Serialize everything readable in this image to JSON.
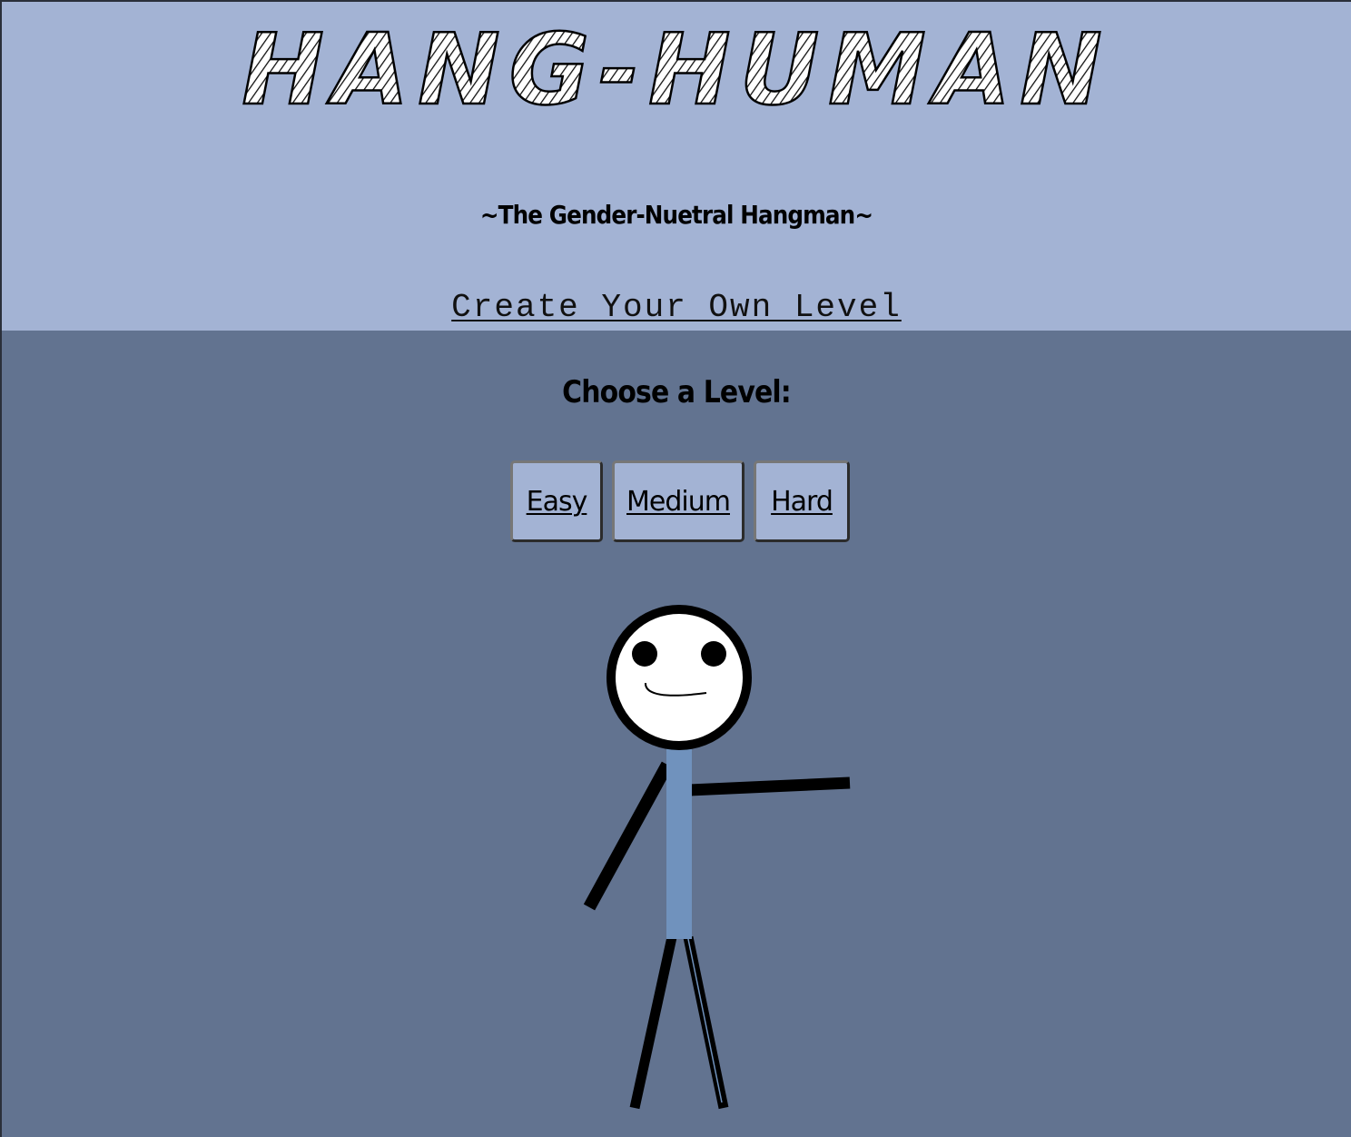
{
  "header": {
    "title": "HANG-HUMAN",
    "subtitle": "~The Gender-Nuetral Hangman~",
    "create_link": "Create Your Own Level"
  },
  "main": {
    "choose_label": "Choose a Level:",
    "levels": [
      {
        "label": "Easy"
      },
      {
        "label": "Medium"
      },
      {
        "label": "Hard"
      }
    ]
  },
  "colors": {
    "header_bg": "#a3b3d4",
    "main_bg": "#627390",
    "button_bg": "#a3b3d4",
    "figure_body": "#7092bd"
  },
  "icons": {
    "figure": "stick-figure-icon"
  }
}
